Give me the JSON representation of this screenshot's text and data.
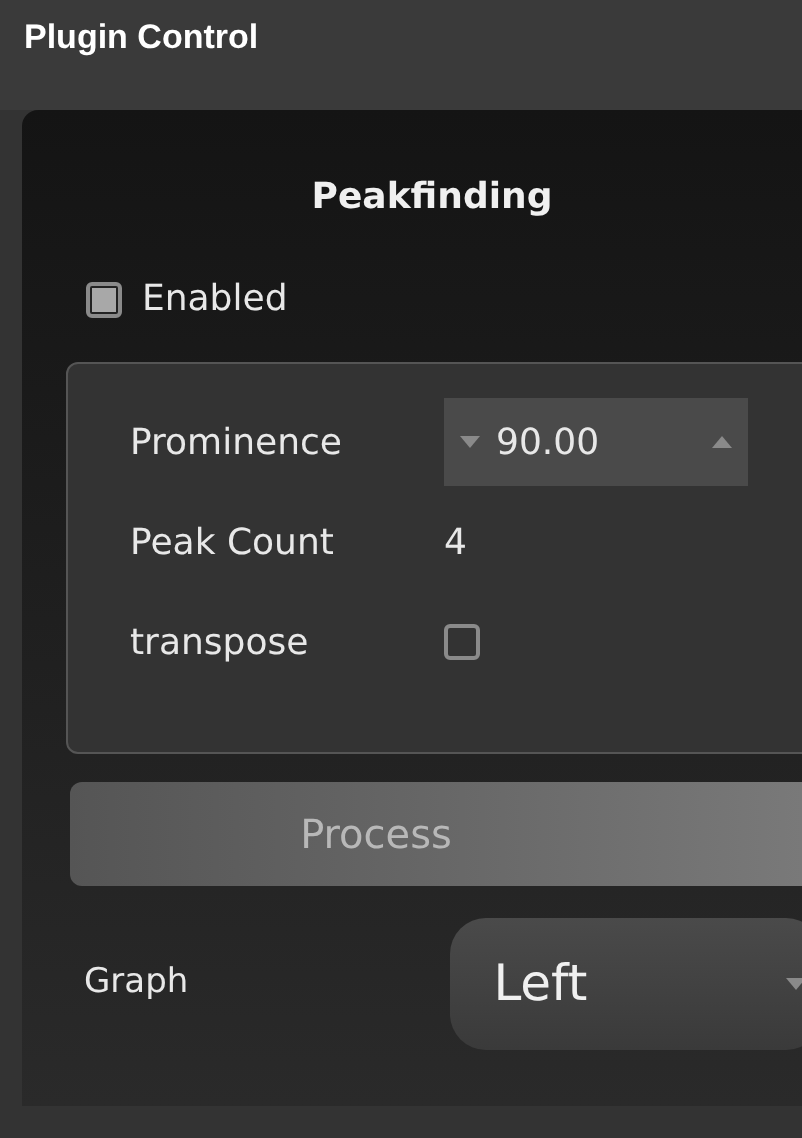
{
  "header": {
    "title": "Plugin Control"
  },
  "plugin": {
    "title": "Peakfinding",
    "enabled": {
      "label": "Enabled",
      "checked": true
    },
    "params": [
      {
        "kind": "spinbox",
        "label": "Prominence",
        "value": "90.00"
      },
      {
        "kind": "value",
        "label": "Peak Count",
        "value": "4"
      },
      {
        "kind": "checkbox",
        "label": "transpose",
        "checked": false
      }
    ],
    "process_button": {
      "label": "Process",
      "disabled": true
    },
    "graph": {
      "label": "Graph",
      "value": "Left"
    }
  }
}
